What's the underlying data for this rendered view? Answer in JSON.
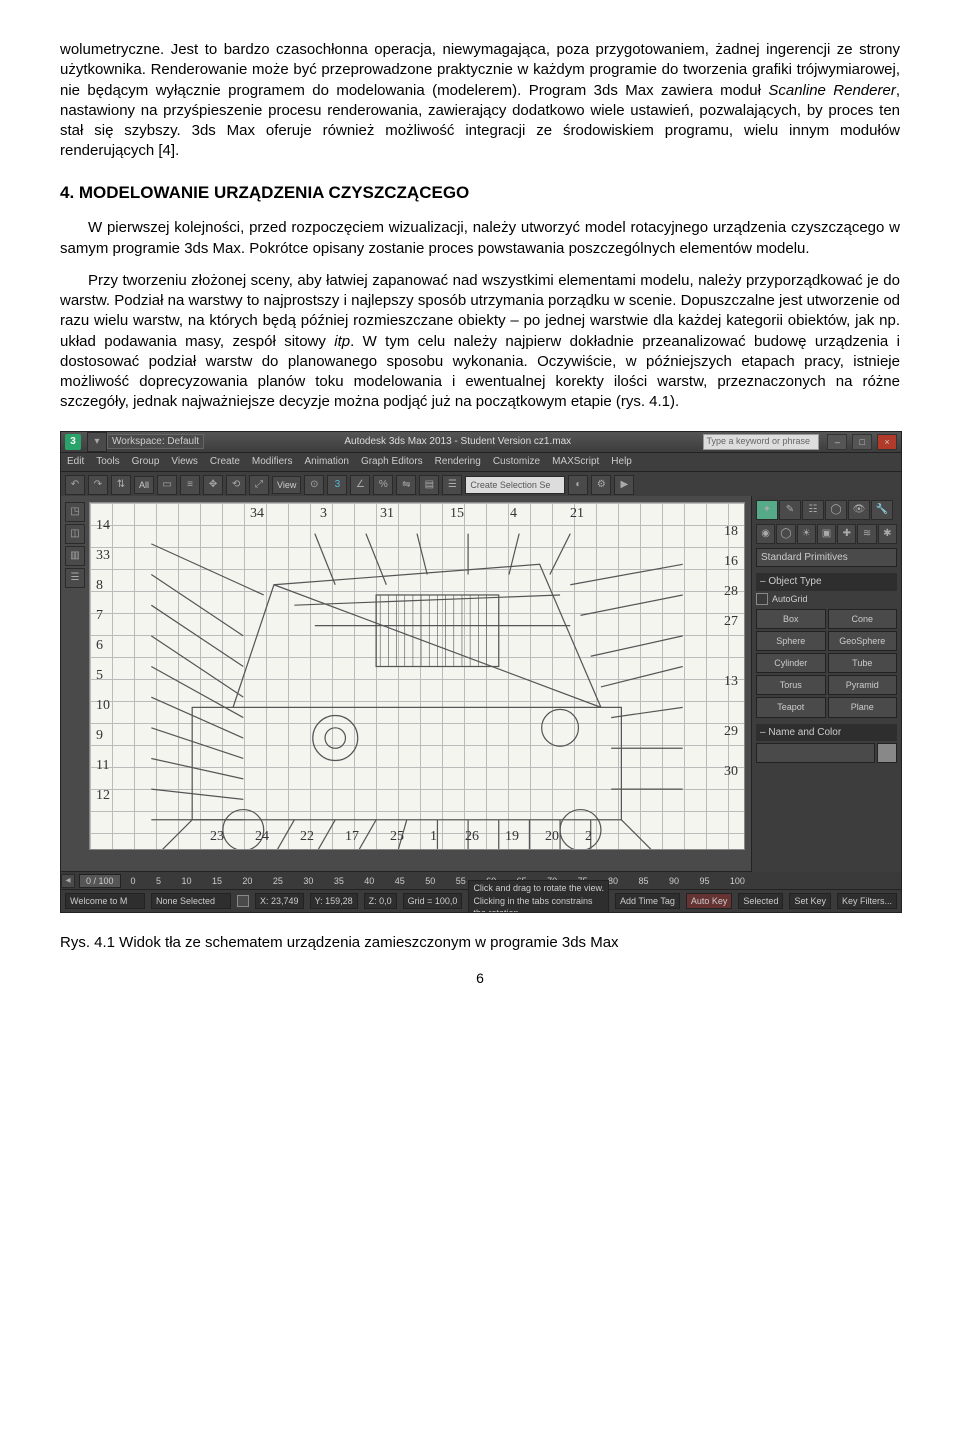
{
  "paragraph1_pre": "wolumetryczne. Jest to bardzo czasochłonna operacja, niewymagająca, poza przygotowaniem, żadnej ingerencji ze strony użytkownika. Renderowanie może być przeprowadzone praktycznie w każdym programie do tworzenia grafiki trójwymiarowej, nie będącym wyłącznie programem do modelowania (modelerem). Program 3ds Max zawiera moduł ",
  "paragraph1_em": "Scanline Renderer",
  "paragraph1_post": ", nastawiony na przyśpieszenie procesu renderowania, zawierający dodatkowo wiele ustawień, pozwalających, by proces ten stał się szybszy. 3ds Max oferuje również możliwość integracji ze środowiskiem programu, wielu innym modułów renderujących [4].",
  "heading": "4. MODELOWANIE URZĄDZENIA CZYSZCZĄCEGO",
  "paragraph2": "W pierwszej kolejności, przed rozpoczęciem wizualizacji, należy utworzyć model rotacyjnego urządzenia czyszczącego w samym programie 3ds Max. Pokrótce opisany zostanie proces powstawania poszczególnych elementów modelu.",
  "paragraph3_pre": "Przy tworzeniu złożonej sceny, aby łatwiej zapanować nad wszystkimi elementami modelu, należy przyporządkować je do warstw. Podział na warstwy to najprostszy i najlepszy sposób utrzymania porządku w scenie. Dopuszczalne jest utworzenie od razu wielu warstw, na których będą później rozmieszczane obiekty – po jednej warstwie dla każdej kategorii obiektów, jak np. układ podawania masy, zespół sitowy ",
  "paragraph3_em": "itp",
  "paragraph3_post": ". W tym celu należy najpierw dokładnie przeanalizować budowę urządzenia i dostosować podział warstw do planowanego sposobu wykonania. Oczywiście, w późniejszych etapach pracy, istnieje możliwość doprecyzowania planów toku modelowania i ewentualnej korekty ilości warstw, przeznaczonych na różne szczegóły, jednak najważniejsze decyzje można podjąć już na początkowym etapie (rys. 4.1).",
  "figure": {
    "workspace_label": "Workspace: Default",
    "app_title": "Autodesk 3ds Max 2013 - Student Version   cz1.max",
    "search_placeholder": "Type a keyword or phrase",
    "menu": [
      "Edit",
      "Tools",
      "Group",
      "Views",
      "Create",
      "Modifiers",
      "Animation",
      "Graph Editors",
      "Rendering",
      "Customize",
      "MAXScript",
      "Help"
    ],
    "toolbar": {
      "dropdown_all": "All",
      "dropdown_view": "View",
      "create_sel": "Create Selection Se"
    },
    "right_panel": {
      "dropdown": "Standard Primitives",
      "section_object_type": "Object Type",
      "autogrid": "AutoGrid",
      "buttons": [
        "Box",
        "Cone",
        "Sphere",
        "GeoSphere",
        "Cylinder",
        "Tube",
        "Torus",
        "Pyramid",
        "Teapot",
        "Plane"
      ],
      "section_name_color": "Name and Color"
    },
    "viewport_numbers_left": [
      "14",
      "33",
      "8",
      "7",
      "6",
      "5",
      "10",
      "9",
      "11",
      "12"
    ],
    "viewport_numbers_top": [
      "34",
      "3",
      "31",
      "15",
      "4",
      "21"
    ],
    "viewport_numbers_right": [
      "18",
      "16",
      "28",
      "27",
      "13",
      "29",
      "30"
    ],
    "viewport_numbers_bottom": [
      "23",
      "24",
      "22",
      "17",
      "25",
      "1",
      "26",
      "19",
      "20",
      "2"
    ],
    "timeline": {
      "tracker": "0 / 100",
      "ticks": [
        "0",
        "5",
        "10",
        "15",
        "20",
        "25",
        "30",
        "35",
        "40",
        "45",
        "50",
        "55",
        "60",
        "65",
        "70",
        "75",
        "80",
        "85",
        "90",
        "95",
        "100"
      ]
    },
    "status": {
      "none_selected": "None Selected",
      "x_label": "X:",
      "x_val": "23,749",
      "y_label": "Y:",
      "y_val": "159,28",
      "z_label": "Z:",
      "z_val": "0,0",
      "grid": "Grid = 100,0",
      "autokey": "Auto Key",
      "selected": "Selected",
      "setkey": "Set Key",
      "keyfilters": "Key Filters...",
      "welcome": "Welcome to M",
      "hint": "Click and drag to rotate the view.  Clicking in the tabs constrains the rotation",
      "addtime": "Add Time Tag"
    }
  },
  "caption": "Rys. 4.1 Widok tła ze schematem urządzenia zamieszczonym w programie 3ds Max",
  "page_number": "6"
}
